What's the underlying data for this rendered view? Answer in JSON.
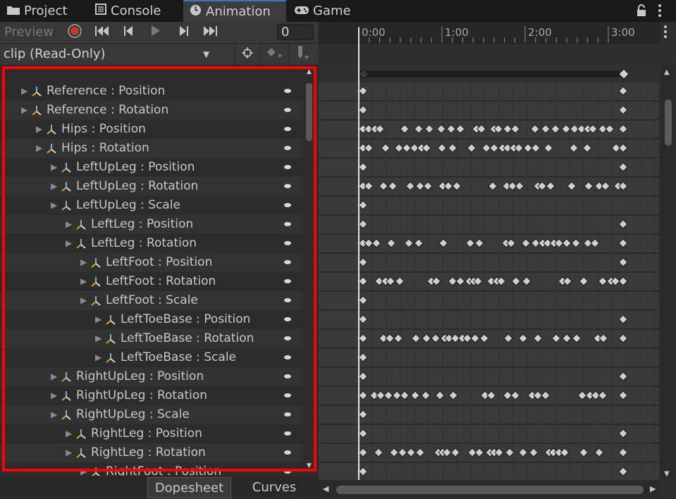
{
  "tabs": [
    {
      "label": "Project",
      "icon": "folder-icon",
      "active": false
    },
    {
      "label": "Console",
      "icon": "console-icon",
      "active": false
    },
    {
      "label": "Animation",
      "icon": "clock-icon",
      "active": true
    },
    {
      "label": "Game",
      "icon": "gamepad-icon",
      "active": false
    }
  ],
  "toolbar": {
    "preview_label": "Preview",
    "frame_value": "0"
  },
  "clip": {
    "selected": "clip (Read-Only)"
  },
  "properties": [
    {
      "label": "Reference : Position",
      "depth": 0
    },
    {
      "label": "Reference : Rotation",
      "depth": 0
    },
    {
      "label": "Hips : Position",
      "depth": 1
    },
    {
      "label": "Hips : Rotation",
      "depth": 1
    },
    {
      "label": "LeftUpLeg : Position",
      "depth": 2
    },
    {
      "label": "LeftUpLeg : Rotation",
      "depth": 2
    },
    {
      "label": "LeftUpLeg : Scale",
      "depth": 2
    },
    {
      "label": "LeftLeg : Position",
      "depth": 3
    },
    {
      "label": "LeftLeg : Rotation",
      "depth": 3
    },
    {
      "label": "LeftFoot : Position",
      "depth": 4
    },
    {
      "label": "LeftFoot : Rotation",
      "depth": 4
    },
    {
      "label": "LeftFoot : Scale",
      "depth": 4
    },
    {
      "label": "LeftToeBase : Position",
      "depth": 5
    },
    {
      "label": "LeftToeBase : Rotation",
      "depth": 5
    },
    {
      "label": "LeftToeBase : Scale",
      "depth": 5
    },
    {
      "label": "RightUpLeg : Position",
      "depth": 2
    },
    {
      "label": "RightUpLeg : Rotation",
      "depth": 2
    },
    {
      "label": "RightUpLeg : Scale",
      "depth": 2
    },
    {
      "label": "RightLeg : Position",
      "depth": 3
    },
    {
      "label": "RightLeg : Rotation",
      "depth": 3
    },
    {
      "label": "RightFoot : Position",
      "depth": 4
    }
  ],
  "timeline": {
    "ruler_labels": [
      "0:00",
      "1:00",
      "2:00",
      "3:00"
    ]
  },
  "bottom_tabs": {
    "dopesheet": "Dopesheet",
    "curves": "Curves"
  },
  "colors": {
    "highlight_box": "#ff0000",
    "active_tab_accent": "#3a79bb"
  }
}
